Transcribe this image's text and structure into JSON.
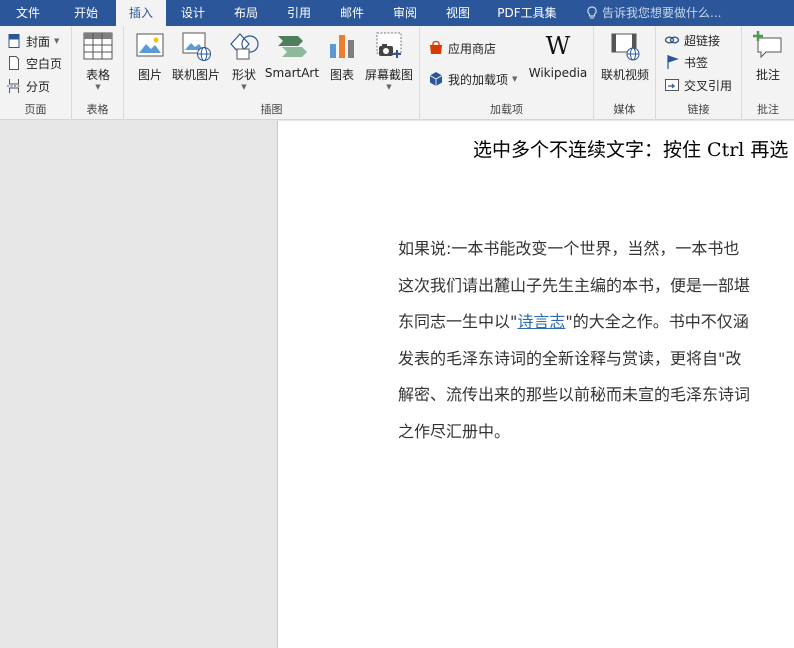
{
  "tabs": [
    "文件",
    "开始",
    "插入",
    "设计",
    "布局",
    "引用",
    "邮件",
    "审阅",
    "视图",
    "PDF工具集"
  ],
  "active_tab": "插入",
  "tell_me": "告诉我您想要做什么...",
  "groups": {
    "pages": {
      "label": "页面",
      "cover": "封面",
      "blank": "空白页",
      "break": "分页"
    },
    "tables": {
      "label": "表格",
      "table": "表格"
    },
    "illustrations": {
      "label": "插图",
      "picture": "图片",
      "online_picture": "联机图片",
      "shapes": "形状",
      "smartart": "SmartArt",
      "chart": "图表",
      "screenshot": "屏幕截图"
    },
    "addins": {
      "label": "加载项",
      "store": "应用商店",
      "my_addins": "我的加载项",
      "wikipedia": "Wikipedia"
    },
    "media": {
      "label": "媒体",
      "online_video": "联机视频"
    },
    "links": {
      "label": "链接",
      "hyperlink": "超链接",
      "bookmark": "书签",
      "cross_ref": "交叉引用"
    },
    "comments": {
      "label": "批注",
      "comment": "批注"
    }
  },
  "document": {
    "heading": "选中多个不连续文字：按住 Ctrl 再选",
    "lines": [
      "如果说:一本书能改变一个世界，当然，一本书也",
      "这次我们请出麓山子先生主编的本书，便是一部堪",
      "发表的毛泽东诗词的全新诠释与赏读，更将自\"改",
      "解密、流传出来的那些以前秘而未宣的毛泽东诗词",
      "之作尽汇册中。"
    ],
    "line3_prefix": "东同志一生中以\"",
    "line3_link": "诗言志",
    "line3_suffix": "\"的大全之作。书中不仅涵"
  },
  "colors": {
    "accent": "#2b579a",
    "ribbon_bg": "#f3f3f3",
    "link": "#2b6cb0"
  }
}
